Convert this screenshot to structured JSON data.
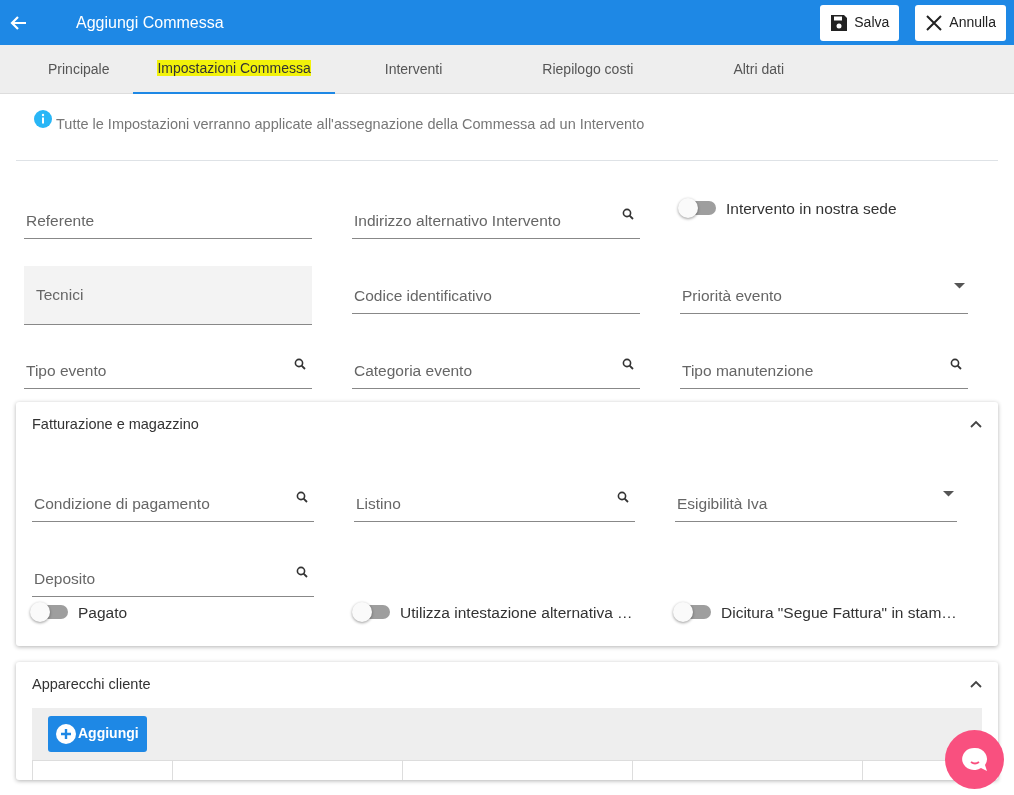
{
  "header": {
    "title": "Aggiungi Commessa",
    "buttons": [
      {
        "label": "Salva",
        "kind": "save"
      },
      {
        "label": "Annulla",
        "kind": "cancel"
      }
    ]
  },
  "tabs": [
    {
      "label": "Principale",
      "selected": false
    },
    {
      "label": "Impostazioni Commessa",
      "selected": true
    },
    {
      "label": "Interventi",
      "selected": false
    },
    {
      "label": "Riepilogo costi",
      "selected": false
    },
    {
      "label": "Altri dati",
      "selected": false
    }
  ],
  "info": "Tutte le Impostazioni verranno applicate all'assegnazione della Commessa ad un Intervento",
  "fields": [
    {
      "kind": "text",
      "placeholder": "Referente"
    },
    {
      "kind": "search",
      "placeholder": "Indirizzo alternativo Intervento"
    },
    {
      "kind": "toggle",
      "label": "Intervento in nostra sede",
      "on": false
    },
    {
      "kind": "filled",
      "placeholder": "Tecnici"
    },
    {
      "kind": "text",
      "placeholder": "Codice identificativo"
    },
    {
      "kind": "select",
      "placeholder": "Priorità evento"
    },
    {
      "kind": "search",
      "placeholder": "Tipo evento"
    },
    {
      "kind": "search",
      "placeholder": "Categoria evento"
    },
    {
      "kind": "search",
      "placeholder": "Tipo manutenzione"
    }
  ],
  "sections": [
    {
      "title": "Fatturazione e magazzino",
      "expanded": true,
      "fields": [
        {
          "kind": "search",
          "placeholder": "Condizione di pagamento"
        },
        {
          "kind": "search",
          "placeholder": "Listino"
        },
        {
          "kind": "select",
          "placeholder": "Esigibilità Iva"
        },
        {
          "kind": "search",
          "placeholder": "Deposito"
        },
        {
          "kind": "blank"
        },
        {
          "kind": "blank"
        },
        {
          "kind": "toggle",
          "label": "Pagato",
          "on": false
        },
        {
          "kind": "toggle",
          "label": "Utilizza intestazione alternativa …",
          "on": false
        },
        {
          "kind": "toggle",
          "label": "Dicitura \"Segue Fattura\" in stam…",
          "on": false
        }
      ]
    },
    {
      "title": "Apparecchi cliente",
      "expanded": true,
      "add_button": "Aggiungi"
    }
  ]
}
